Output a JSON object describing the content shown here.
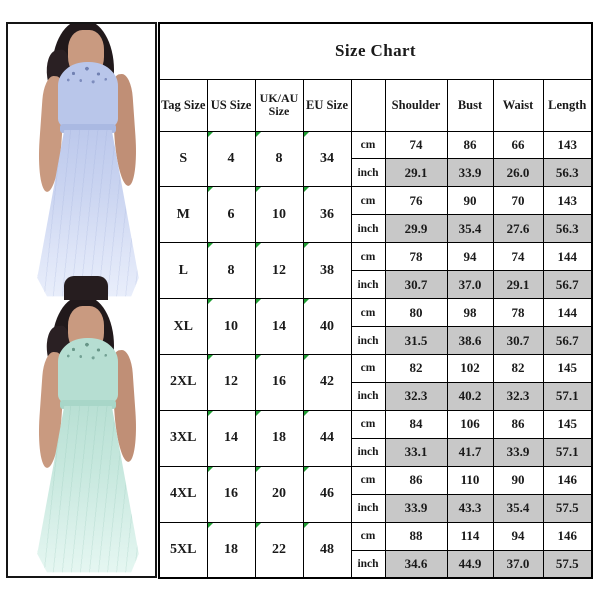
{
  "product_images": [
    {
      "name": "dress-periwinkle",
      "alt": "Model wearing lavender blue sleeveless lace chiffon maxi dress",
      "color_hex": "#c3cff0"
    },
    {
      "name": "dress-mint",
      "alt": "Model wearing mint green sleeveless lace chiffon maxi dress",
      "color_hex": "#c1e5d9"
    }
  ],
  "chart": {
    "title": "Size Chart",
    "headers": {
      "tag_size": "Tag Size",
      "us_size": "US Size",
      "uk_au_size": "UK/AU Size",
      "eu_size": "EU Size",
      "unit": "",
      "shoulder": "Shoulder",
      "bust": "Bust",
      "waist": "Waist",
      "length": "Length"
    },
    "unit_labels": {
      "cm": "cm",
      "inch": "inch"
    },
    "accent_marker_hex": "#1f9d33",
    "inch_row_bg_hex": "#c8c8c8",
    "rows": [
      {
        "tag_size": "S",
        "us_size": "4",
        "uk_au_size": "8",
        "eu_size": "34",
        "cm": {
          "shoulder": "74",
          "bust": "86",
          "waist": "66",
          "length": "143"
        },
        "inch": {
          "shoulder": "29.1",
          "bust": "33.9",
          "waist": "26.0",
          "length": "56.3"
        }
      },
      {
        "tag_size": "M",
        "us_size": "6",
        "uk_au_size": "10",
        "eu_size": "36",
        "cm": {
          "shoulder": "76",
          "bust": "90",
          "waist": "70",
          "length": "143"
        },
        "inch": {
          "shoulder": "29.9",
          "bust": "35.4",
          "waist": "27.6",
          "length": "56.3"
        }
      },
      {
        "tag_size": "L",
        "us_size": "8",
        "uk_au_size": "12",
        "eu_size": "38",
        "cm": {
          "shoulder": "78",
          "bust": "94",
          "waist": "74",
          "length": "144"
        },
        "inch": {
          "shoulder": "30.7",
          "bust": "37.0",
          "waist": "29.1",
          "length": "56.7"
        }
      },
      {
        "tag_size": "XL",
        "us_size": "10",
        "uk_au_size": "14",
        "eu_size": "40",
        "cm": {
          "shoulder": "80",
          "bust": "98",
          "waist": "78",
          "length": "144"
        },
        "inch": {
          "shoulder": "31.5",
          "bust": "38.6",
          "waist": "30.7",
          "length": "56.7"
        }
      },
      {
        "tag_size": "2XL",
        "us_size": "12",
        "uk_au_size": "16",
        "eu_size": "42",
        "cm": {
          "shoulder": "82",
          "bust": "102",
          "waist": "82",
          "length": "145"
        },
        "inch": {
          "shoulder": "32.3",
          "bust": "40.2",
          "waist": "32.3",
          "length": "57.1"
        }
      },
      {
        "tag_size": "3XL",
        "us_size": "14",
        "uk_au_size": "18",
        "eu_size": "44",
        "cm": {
          "shoulder": "84",
          "bust": "106",
          "waist": "86",
          "length": "145"
        },
        "inch": {
          "shoulder": "33.1",
          "bust": "41.7",
          "waist": "33.9",
          "length": "57.1"
        }
      },
      {
        "tag_size": "4XL",
        "us_size": "16",
        "uk_au_size": "20",
        "eu_size": "46",
        "cm": {
          "shoulder": "86",
          "bust": "110",
          "waist": "90",
          "length": "146"
        },
        "inch": {
          "shoulder": "33.9",
          "bust": "43.3",
          "waist": "35.4",
          "length": "57.5"
        }
      },
      {
        "tag_size": "5XL",
        "us_size": "18",
        "uk_au_size": "22",
        "eu_size": "48",
        "cm": {
          "shoulder": "88",
          "bust": "114",
          "waist": "94",
          "length": "146"
        },
        "inch": {
          "shoulder": "34.6",
          "bust": "44.9",
          "waist": "37.0",
          "length": "57.5"
        }
      }
    ]
  }
}
